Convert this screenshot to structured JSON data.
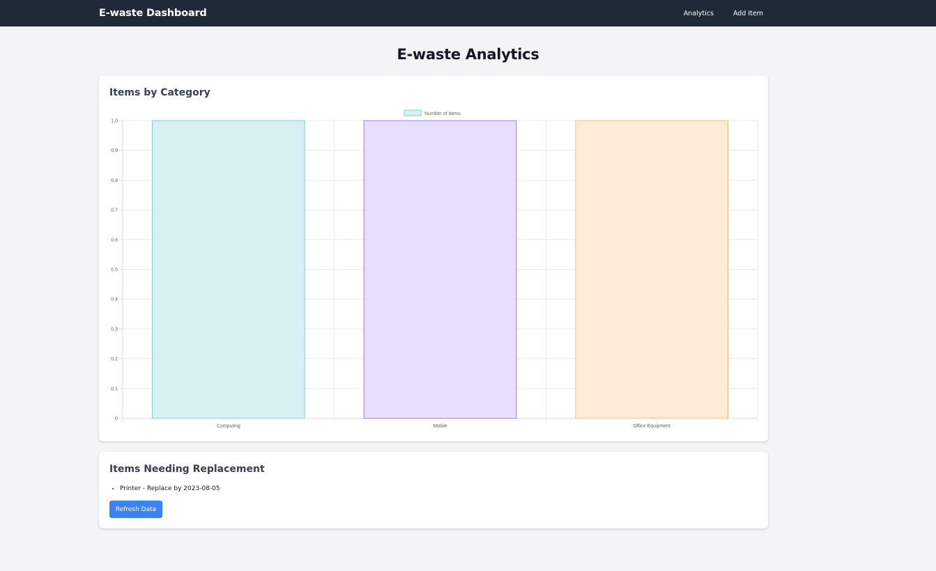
{
  "nav": {
    "brand": "E-waste Dashboard",
    "links": [
      {
        "label": "Analytics"
      },
      {
        "label": "Add Item"
      }
    ]
  },
  "page": {
    "title": "E-waste Analytics"
  },
  "category_card": {
    "title": "Items by Category"
  },
  "replacement_card": {
    "title": "Items Needing Replacement",
    "items": [
      "Printer - Replace by 2023-08-05"
    ],
    "refresh_label": "Refresh Data"
  },
  "chart_data": {
    "type": "bar",
    "categories": [
      "Computing",
      "Mobile",
      "Office Equipment"
    ],
    "series": [
      {
        "name": "Number of Items",
        "values": [
          1,
          1,
          1
        ]
      }
    ],
    "ylim": [
      0,
      1
    ],
    "yticks": [
      "0",
      "0.1",
      "0.2",
      "0.3",
      "0.4",
      "0.5",
      "0.6",
      "0.7",
      "0.8",
      "0.9",
      "1.0"
    ],
    "grid": true,
    "legend": "top-center",
    "bar_fills": [
      "#d8f0f1",
      "#e9dffd",
      "#ffebd6"
    ],
    "bar_strokes": [
      "#7ecfd3",
      "#9b7fe6",
      "#f4bd84"
    ],
    "legend_fill": "#d8f0f1",
    "legend_stroke": "#7ecfd3"
  }
}
